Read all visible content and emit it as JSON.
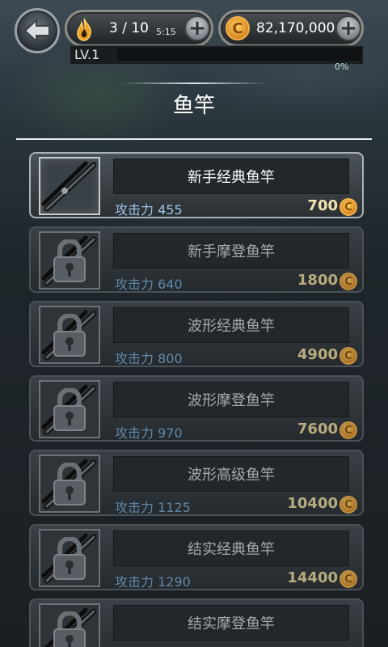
{
  "header": {
    "energy": "3 / 10",
    "timer": "5:15",
    "coins": "82,170,000",
    "level": "LV.1",
    "xp_percent": "0%",
    "xp_fraction": 0
  },
  "title": "鱼竿",
  "coin_symbol": "C",
  "plus_symbol": "+",
  "rods": [
    {
      "name": "新手经典鱼竿",
      "attack": "攻击力 455",
      "price": "700",
      "locked": false
    },
    {
      "name": "新手摩登鱼竿",
      "attack": "攻击力 640",
      "price": "1800",
      "locked": true
    },
    {
      "name": "波形经典鱼竿",
      "attack": "攻击力 800",
      "price": "4900",
      "locked": true
    },
    {
      "name": "波形摩登鱼竿",
      "attack": "攻击力 970",
      "price": "7600",
      "locked": true
    },
    {
      "name": "波形高级鱼竿",
      "attack": "攻击力 1125",
      "price": "10400",
      "locked": true
    },
    {
      "name": "结实经典鱼竿",
      "attack": "攻击力 1290",
      "price": "14400",
      "locked": true
    },
    {
      "name": "结实摩登鱼竿",
      "attack": "",
      "price": "",
      "locked": true
    }
  ],
  "icons": {
    "back": "back-arrow-icon",
    "energy": "flame-icon",
    "coin": "coin-icon",
    "lock": "padlock-icon",
    "rod": "fishing-rod-icon"
  },
  "colors": {
    "accent_gold": "#f4e5b0",
    "attack_blue": "#9cc3e6"
  }
}
